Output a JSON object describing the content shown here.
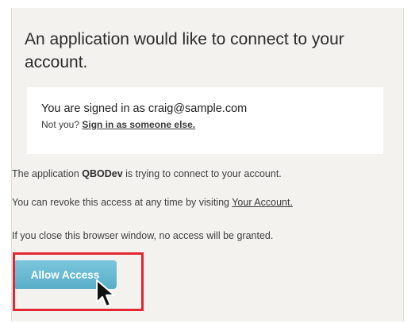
{
  "heading": "An application would like to connect to your account.",
  "signin": {
    "prefix": "You are signed in as ",
    "email": "craig@sample.com",
    "not_you": "Not you? ",
    "switch_link": "Sign in as someone else."
  },
  "messages": {
    "connect_prefix": "The application ",
    "app_name": "QBODev",
    "connect_suffix": " is trying to connect to your account.",
    "revoke_prefix": "You can revoke this access at any time by visiting ",
    "revoke_link": "Your Account.",
    "close_warning": "If you close this browser window, no access will be granted."
  },
  "allow_button_label": "Allow Access",
  "colors": {
    "button": "#6ab9d2",
    "highlight": "#e3262f",
    "panel": "#f3f2ef"
  },
  "icons": {
    "cursor": "arrow-pointer-icon"
  }
}
